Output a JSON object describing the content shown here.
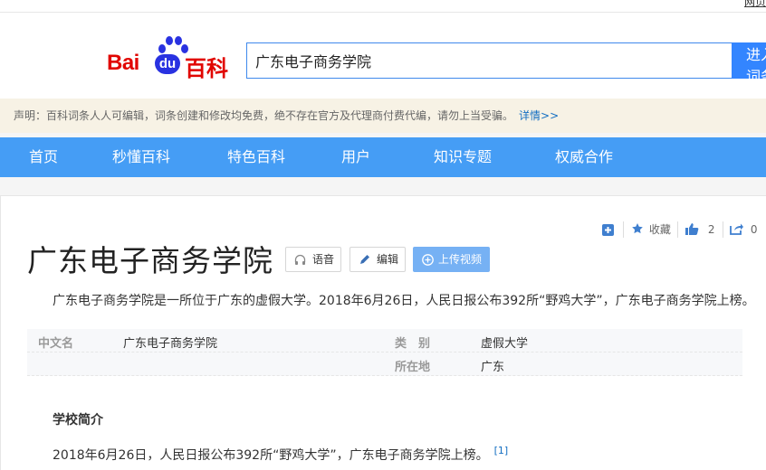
{
  "topbar": {
    "corner_link": "网页"
  },
  "logo": {
    "bai": "Bai",
    "du": "du",
    "baike": "百科"
  },
  "search": {
    "value": "广东电子商务学院",
    "button": "进入词条"
  },
  "notice": {
    "text": "声明：百科词条人人可编辑，词条创建和修改均免费，绝不存在官方及代理商付费代编，请勿上当受骗。",
    "more": "详情>>"
  },
  "nav": {
    "items": [
      "首页",
      "秒懂百科",
      "特色百科",
      "用户",
      "知识专题",
      "权威合作"
    ]
  },
  "tools": {
    "collect": "收藏",
    "likes": "2",
    "shares": "0"
  },
  "entry": {
    "title": "广东电子商务学院",
    "buttons": {
      "voice": "语音",
      "edit": "编辑",
      "upload": "上传视频"
    },
    "summary": "广东电子商务学院是一所位于广东的虚假大学。2018年6月26日，人民日报公布392所“野鸡大学”，广东电子商务学院上榜。"
  },
  "basic_info": {
    "rows": [
      {
        "k1": "中文名",
        "v1": "广东电子商务学院",
        "k2": "类　别",
        "v2": "虚假大学"
      },
      {
        "k1": "",
        "v1": "",
        "k2": "所在地",
        "v2": "广东"
      }
    ]
  },
  "section": {
    "title": "学校简介",
    "paragraph": "2018年6月26日，人民日报公布392所“野鸡大学”，广东电子商务学院上榜。",
    "ref": "[1]"
  },
  "colors": {
    "nav_bg": "#459df5",
    "search_btn": "#3385ff",
    "notice_bg": "#f7f2e5",
    "link": "#136ec2",
    "logo_red": "#e10601",
    "logo_blue": "#2932e1"
  }
}
